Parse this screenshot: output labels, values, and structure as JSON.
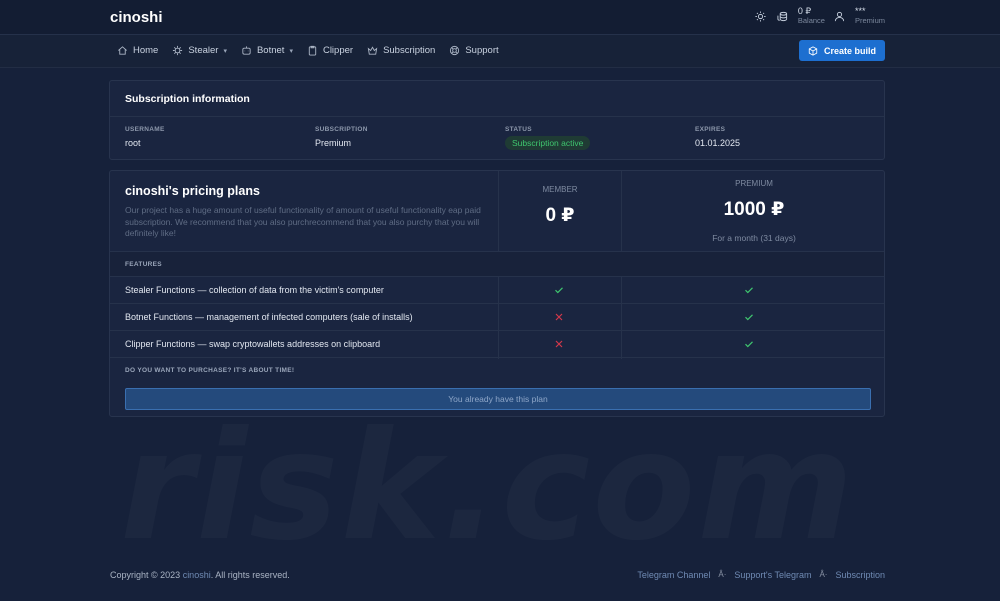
{
  "brand": "cinoshi",
  "topbar": {
    "balance_value": "0 ₽",
    "balance_label": "Balance",
    "user_value": "***",
    "user_label": "Premium"
  },
  "nav": [
    {
      "label": "Home",
      "icon": "home-icon"
    },
    {
      "label": "Stealer",
      "icon": "bug-icon",
      "caret": true
    },
    {
      "label": "Botnet",
      "icon": "robot-icon",
      "caret": true
    },
    {
      "label": "Clipper",
      "icon": "clipboard-icon"
    },
    {
      "label": "Subscription",
      "icon": "crown-icon"
    },
    {
      "label": "Support",
      "icon": "lifebuoy-icon"
    }
  ],
  "create_build_label": "Create build",
  "subscription_info": {
    "title": "Subscription information",
    "username_label": "USERNAME",
    "username": "root",
    "subscription_label": "SUBSCRIPTION",
    "subscription": "Premium",
    "status_label": "STATUS",
    "status": "Subscription active",
    "expires_label": "EXPIRES",
    "expires": "01.01.2025"
  },
  "pricing": {
    "title": "cinoshi's pricing plans",
    "description": "Our project has a huge amount of useful functionality  of amount of useful functionality eap paid subscription. We recommend that you also purchrecommend that you also purchy that you will definitely like!",
    "member_label": "MEMBER",
    "member_price": "0 ₽",
    "premium_label": "PREMIUM",
    "premium_price": "1000 ₽",
    "premium_note": "For a month (31 days)",
    "features_label": "FEATURES",
    "features": [
      {
        "text": "Stealer Functions — collection of data from the victim's computer",
        "member": true,
        "premium": true
      },
      {
        "text": "Botnet Functions — management of infected computers (sale of installs)",
        "member": false,
        "premium": true
      },
      {
        "text": "Clipper Functions — swap cryptowallets addresses on clipboard",
        "member": false,
        "premium": true
      }
    ],
    "purchase_label": "DO YOU WANT TO PURCHASE? IT'S ABOUT TIME!",
    "purchase_button": "You already have this plan"
  },
  "footer": {
    "copyright_prefix": "Copyright © 2023",
    "copyright_brand": "cinoshi",
    "copyright_suffix": ". All rights reserved.",
    "links": [
      "Telegram Channel",
      "Support's Telegram",
      "Subscription"
    ],
    "link_separator": "Â·"
  },
  "watermark": "risk.com",
  "colors": {
    "accent": "#1d6fd0",
    "success": "#3fc66f",
    "danger": "#d2384a",
    "background": "#16213a"
  }
}
